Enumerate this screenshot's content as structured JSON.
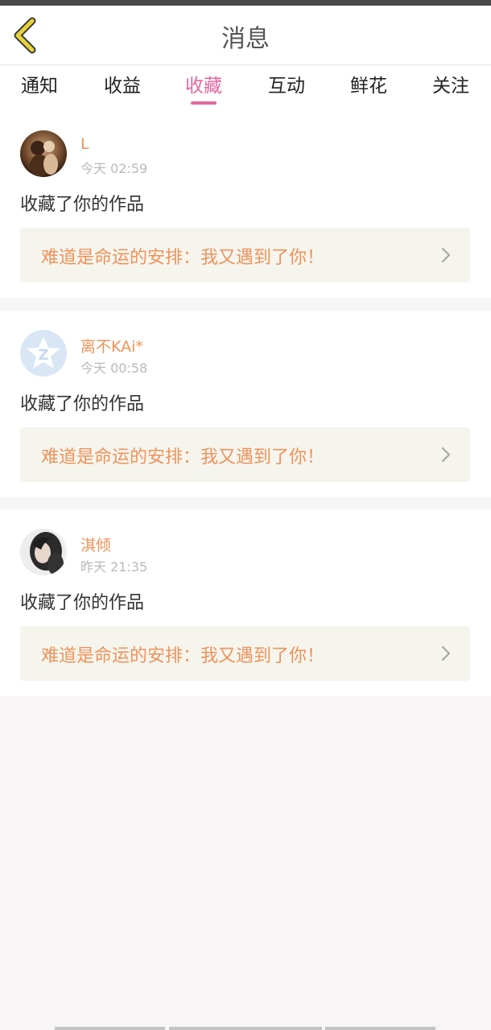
{
  "header": {
    "title": "消息",
    "back_icon": "chevron-left-icon",
    "back_color": "#e8d23a"
  },
  "tabs": [
    {
      "label": "通知",
      "active": false
    },
    {
      "label": "收益",
      "active": false
    },
    {
      "label": "收藏",
      "active": true
    },
    {
      "label": "互动",
      "active": false
    },
    {
      "label": "鲜花",
      "active": false
    },
    {
      "label": "关注",
      "active": false
    }
  ],
  "accent_color": "#e4689f",
  "name_color": "#f0925a",
  "messages": [
    {
      "username": "L",
      "time": "今天 02:59",
      "action": "收藏了你的作品",
      "work_title": "难道是命运的安排：我又遇到了你！"
    },
    {
      "username": "离不KAi*",
      "time": "今天 00:58",
      "action": "收藏了你的作品",
      "work_title": "难道是命运的安排：我又遇到了你！"
    },
    {
      "username": "淇倾",
      "time": "昨天 21:35",
      "action": "收藏了你的作品",
      "work_title": "难道是命运的安排：我又遇到了你！"
    }
  ]
}
